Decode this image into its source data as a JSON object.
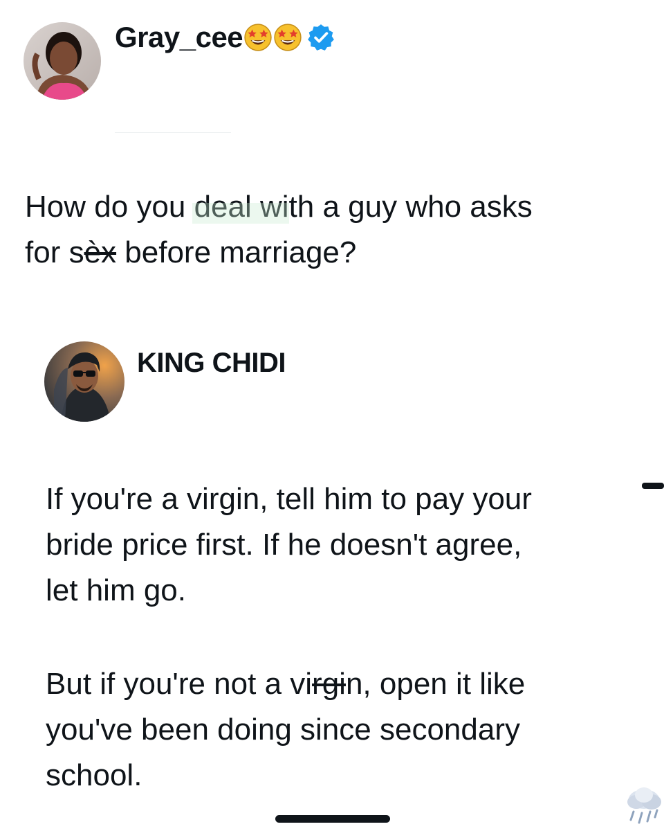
{
  "post1": {
    "author": {
      "display_name": "Gray_cee",
      "emoji_1": "star-struck-emoji",
      "emoji_2": "star-struck-emoji",
      "badge": "verified-badge-icon",
      "badge_color": "#1d9bf0"
    },
    "text": {
      "line1": {
        "before": "How do you ",
        "word": "deal",
        "after": " with a guy who asks"
      },
      "line2": {
        "before": "for s",
        "struck": "èx",
        "after": " before marriage?"
      }
    }
  },
  "post2": {
    "author": {
      "display_name": "KING CHIDI"
    },
    "paragraph1": {
      "line1": "If you're a virgin, tell him to pay your",
      "line2": "bride price first. If he doesn't agree,",
      "line3": "let him go."
    },
    "paragraph2": {
      "line1": {
        "before": "But if you're not a vi",
        "struck": "rgi",
        "after": "n, open it like"
      },
      "line2": "you've been doing since secondary",
      "line3": "school."
    }
  },
  "icons": {
    "weather": "cloud-storm-icon"
  }
}
